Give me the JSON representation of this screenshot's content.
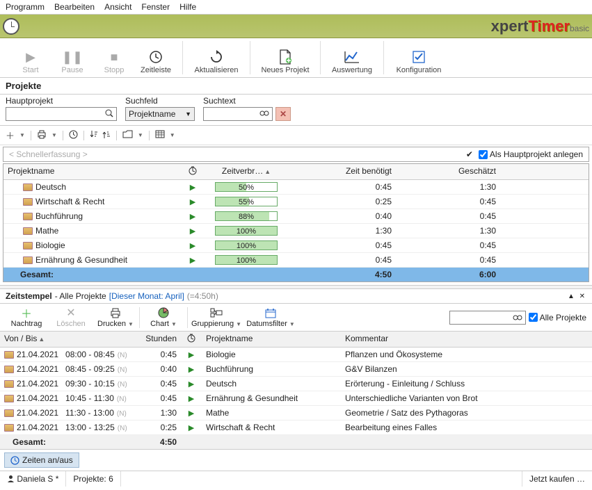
{
  "menu": {
    "programm": "Programm",
    "bearbeiten": "Bearbeiten",
    "ansicht": "Ansicht",
    "fenster": "Fenster",
    "hilfe": "Hilfe"
  },
  "brand": {
    "x": "xpert",
    "t": "Timer",
    "b": "basic"
  },
  "toolbar": {
    "start": "Start",
    "pause": "Pause",
    "stopp": "Stopp",
    "zeitleiste": "Zeitleiste",
    "aktual": "Aktualisieren",
    "neues": "Neues Projekt",
    "auswert": "Auswertung",
    "konfig": "Konfiguration"
  },
  "sections": {
    "projekte": "Projekte"
  },
  "filter": {
    "hauptprojekt": "Hauptprojekt",
    "suchfeld": "Suchfeld",
    "projektname": "Projektname",
    "suchtext": "Suchtext"
  },
  "quick": {
    "placeholder": "< Schnellerfassung >",
    "hp_check": "Als Hauptprojekt anlegen"
  },
  "proj_head": {
    "name": "Projektname",
    "zeitv": "Zeitverbr…",
    "zeitb": "Zeit benötigt",
    "gesch": "Geschätzt"
  },
  "projects": [
    {
      "name": "Deutsch",
      "pct": 50,
      "zb": "0:45",
      "gs": "1:30"
    },
    {
      "name": "Wirtschaft & Recht",
      "pct": 55,
      "zb": "0:25",
      "gs": "0:45"
    },
    {
      "name": "Buchführung",
      "pct": 88,
      "zb": "0:40",
      "gs": "0:45"
    },
    {
      "name": "Mathe",
      "pct": 100,
      "zb": "1:30",
      "gs": "1:30"
    },
    {
      "name": "Biologie",
      "pct": 100,
      "zb": "0:45",
      "gs": "0:45"
    },
    {
      "name": "Ernährung & Gesundheit",
      "pct": 100,
      "zb": "0:45",
      "gs": "0:45"
    }
  ],
  "proj_total": {
    "label": "Gesamt:",
    "zb": "4:50",
    "gs": "6:00"
  },
  "ts_header": {
    "title": "Zeitstempel",
    "sub": " - Alle Projekte",
    "month": "[Dieser Monat: April]",
    "dur": "(=4:50h)"
  },
  "ts_toolbar": {
    "nachtrag": "Nachtrag",
    "loeschen": "Löschen",
    "drucken": "Drucken",
    "chart": "Chart",
    "gruppierung": "Gruppierung",
    "datumsfilter": "Datumsfilter",
    "alle": "Alle Projekte"
  },
  "ts_head": {
    "vb": "Von / Bis",
    "st": "Stunden",
    "pn": "Projektname",
    "km": "Kommentar"
  },
  "timestamps": [
    {
      "date": "21.04.2021",
      "time": "08:00 - 08:45",
      "h": "0:45",
      "proj": "Biologie",
      "km": "Pflanzen und Ökosysteme"
    },
    {
      "date": "21.04.2021",
      "time": "08:45 - 09:25",
      "h": "0:40",
      "proj": "Buchführung",
      "km": "G&V Bilanzen"
    },
    {
      "date": "21.04.2021",
      "time": "09:30 - 10:15",
      "h": "0:45",
      "proj": "Deutsch",
      "km": "Erörterung - Einleitung / Schluss"
    },
    {
      "date": "21.04.2021",
      "time": "10:45 - 11:30",
      "h": "0:45",
      "proj": "Ernährung & Gesundheit",
      "km": "Unterschiedliche Varianten von Brot"
    },
    {
      "date": "21.04.2021",
      "time": "11:30 - 13:00",
      "h": "1:30",
      "proj": "Mathe",
      "km": "Geometrie / Satz des Pythagoras"
    },
    {
      "date": "21.04.2021",
      "time": "13:00 - 13:25",
      "h": "0:25",
      "proj": "Wirtschaft & Recht",
      "km": "Bearbeitung eines Falles"
    }
  ],
  "ts_total": {
    "label": "Gesamt:",
    "h": "4:50"
  },
  "toggle": {
    "label": "Zeiten an/aus"
  },
  "status": {
    "user": "Daniela S *",
    "projects": "Projekte: 6",
    "buy": "Jetzt kaufen …"
  }
}
